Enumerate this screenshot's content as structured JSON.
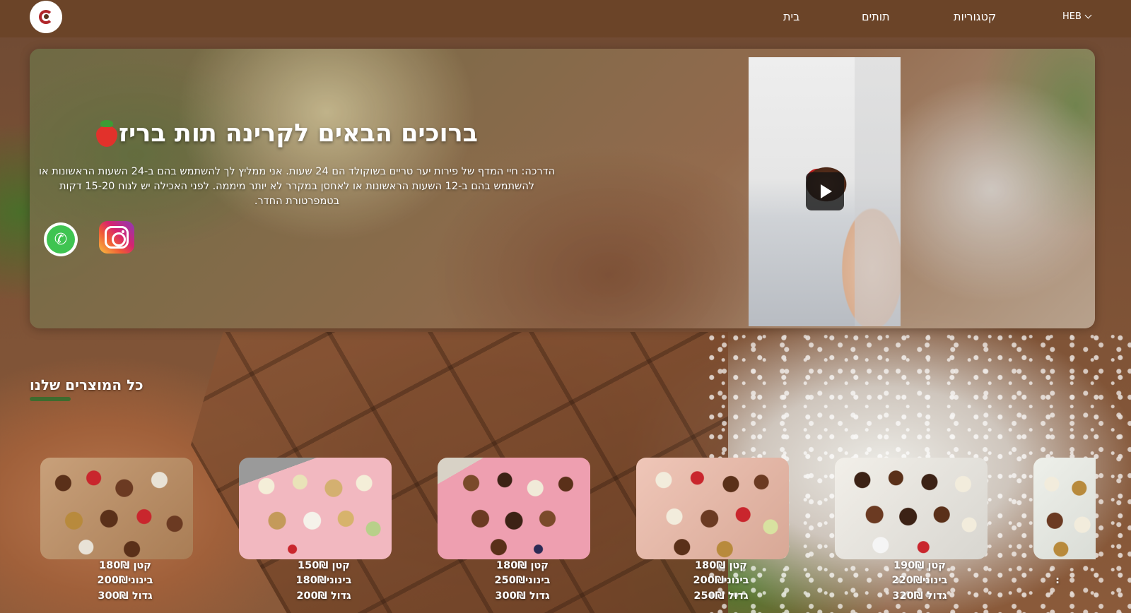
{
  "header": {
    "logo_alt": "KArinaBerri",
    "nav": [
      {
        "label": "בית"
      },
      {
        "label": "תותים"
      },
      {
        "label": "קטגוריות"
      }
    ],
    "language": "HEB"
  },
  "hero": {
    "title": "ברוכים הבאים לקרינה תות בריז",
    "description": "הדרכה: חיי המדף של פירות יער טריים בשוקולד הם 24 שעות. אני ממליץ לך להשתמש בהם ב-24 השעות הראשונות או להשתמש בהם ב-12 השעות הראשונות או לאחסן במקרר לא יותר מיממה. לפני האכילה יש לנוח 15-20 דקות בטמפרטורת החדר.",
    "social": [
      {
        "icon": "whatsapp-icon"
      },
      {
        "icon": "instagram-icon"
      }
    ],
    "video": {
      "icon": "play-icon"
    }
  },
  "products_section": {
    "title": "כל המוצרים שלנו",
    "accent_color": "#3e6b2e",
    "products": [
      {
        "small": "קטן 180₪",
        "medium": "בינוני200₪",
        "large": "גדול 300₪",
        "tray": "#c8a07a"
      },
      {
        "small": "קטן 150₪",
        "medium": "בינוני180₪",
        "large": "גדול 200₪",
        "tray": "#f2b8c0"
      },
      {
        "small": "קטן 180₪",
        "medium": "בינוני250₪",
        "large": "גדול 300₪",
        "tray": "#ee9fb0"
      },
      {
        "small": "קטן 180₪",
        "medium": "בינוני200₪",
        "large": "גדול 250₪",
        "tray": "#efc6b8"
      },
      {
        "small": "קטן 190₪",
        "medium": "בינוני220₪",
        "large": "גדול 320₪",
        "tray": "#f2efe9"
      },
      {
        "small": "",
        "medium": ":",
        "large": "",
        "tray": "#eef0ea"
      }
    ]
  },
  "colors": {
    "header_bg": "#6b4428",
    "text": "#ffffff"
  }
}
